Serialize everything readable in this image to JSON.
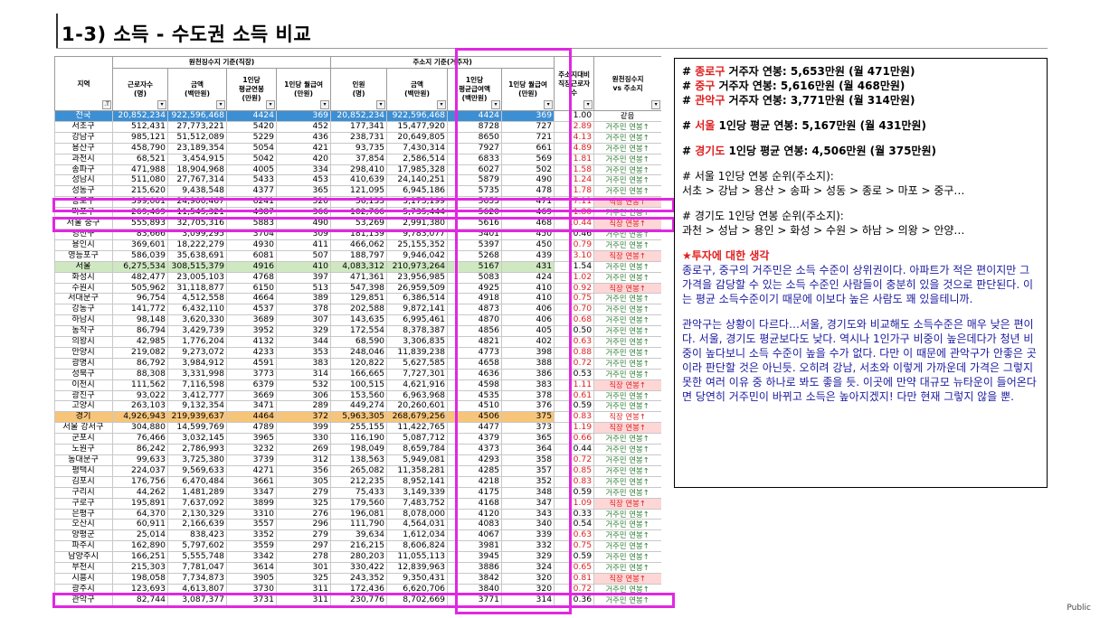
{
  "title": "1-3) 소득 - 수도권 소득 비교",
  "footer": "Public",
  "table": {
    "group_headers": {
      "workplace": "원천징수지 기준(직장)",
      "residence": "주소지 기준(거주자)"
    },
    "columns": [
      "지역",
      "근로자수\n(명)",
      "금액\n(백만원)",
      "1인당\n평균연봉\n(만원)",
      "1인당 월급여\n(만원)",
      "인원\n(명)",
      "금액\n(백만원)",
      "1인당\n평균급여액\n(백만원)",
      "1인당 월급여\n(만원)",
      "주소지대비\n직장근로자\n수",
      "원천징수지\nvs 주소지"
    ],
    "rows": [
      [
        "전국",
        "20,852,234",
        "922,596,468",
        "4424",
        "369",
        "20,852,234",
        "922,596,468",
        "4424",
        "369",
        "1.00",
        "같음",
        "blue"
      ],
      [
        "서초구",
        "512,431",
        "27,773,221",
        "5420",
        "452",
        "177,341",
        "15,477,920",
        "8728",
        "727",
        "2.89",
        "거주민 연봉↑",
        "red"
      ],
      [
        "강남구",
        "985,121",
        "51,512,089",
        "5229",
        "436",
        "238,731",
        "20,649,805",
        "8650",
        "721",
        "4.13",
        "거주민 연봉↑",
        "red"
      ],
      [
        "용산구",
        "458,790",
        "23,189,354",
        "5054",
        "421",
        "93,735",
        "7,430,314",
        "7927",
        "661",
        "4.89",
        "거주민 연봉↑",
        "red"
      ],
      [
        "과천시",
        "68,521",
        "3,454,915",
        "5042",
        "420",
        "37,854",
        "2,586,514",
        "6833",
        "569",
        "1.81",
        "거주민 연봉↑",
        "red"
      ],
      [
        "송파구",
        "471,988",
        "18,904,968",
        "4005",
        "334",
        "298,410",
        "17,985,328",
        "6027",
        "502",
        "1.58",
        "거주민 연봉↑",
        "red"
      ],
      [
        "성남시",
        "511,080",
        "27,767,314",
        "5433",
        "453",
        "410,639",
        "24,140,251",
        "5879",
        "490",
        "1.24",
        "거주민 연봉↑",
        "red"
      ],
      [
        "성동구",
        "215,620",
        "9,438,548",
        "4377",
        "365",
        "121,095",
        "6,945,186",
        "5735",
        "478",
        "1.78",
        "거주민 연봉↑",
        "red"
      ],
      [
        "종로구",
        "399,001",
        "24,900,467",
        "6241",
        "520",
        "56,133",
        "3,173,199",
        "5653",
        "471",
        "7.11",
        "직장 연봉↑",
        "red"
      ],
      [
        "마포구",
        "269,469",
        "11,545,321",
        "4387",
        "366",
        "102,766",
        "5,735,444",
        "5620",
        "469",
        "1.80",
        "거주민 연봉↑",
        "red"
      ],
      [
        "서울 중구",
        "555,893",
        "32,705,316",
        "5883",
        "490",
        "53,269",
        "2,991,380",
        "5616",
        "468",
        "10.44",
        "직장 연봉↑",
        "red"
      ],
      [
        "영천구",
        "83,666",
        "3,099,295",
        "3704",
        "309",
        "181,139",
        "9,783,077",
        "5401",
        "450",
        "0.46",
        "거주민 연봉↑",
        ""
      ],
      [
        "용인시",
        "369,601",
        "18,222,279",
        "4930",
        "411",
        "466,062",
        "25,155,352",
        "5397",
        "450",
        "0.79",
        "거주민 연봉↑",
        "red"
      ],
      [
        "영등포구",
        "586,039",
        "35,638,691",
        "6081",
        "507",
        "188,797",
        "9,946,042",
        "5268",
        "439",
        "3.10",
        "직장 연봉↑",
        "red"
      ],
      [
        "서울",
        "6,275,534",
        "308,515,379",
        "4916",
        "410",
        "4,083,312",
        "210,973,264",
        "5167",
        "431",
        "1.54",
        "거주민 연봉↑",
        "green"
      ],
      [
        "화성시",
        "482,477",
        "23,005,103",
        "4768",
        "397",
        "471,361",
        "23,956,985",
        "5083",
        "424",
        "1.02",
        "거주민 연봉↑",
        "red"
      ],
      [
        "수원시",
        "505,962",
        "31,118,877",
        "6150",
        "513",
        "547,398",
        "26,959,509",
        "4925",
        "410",
        "0.92",
        "직장 연봉↑",
        "red"
      ],
      [
        "서대문구",
        "96,754",
        "4,512,558",
        "4664",
        "389",
        "129,851",
        "6,386,514",
        "4918",
        "410",
        "0.75",
        "거주민 연봉↑",
        "red"
      ],
      [
        "강동구",
        "141,772",
        "6,432,110",
        "4537",
        "378",
        "202,588",
        "9,872,141",
        "4873",
        "406",
        "0.70",
        "거주민 연봉↑",
        "red"
      ],
      [
        "하남시",
        "98,148",
        "3,620,330",
        "3689",
        "307",
        "143,635",
        "6,995,461",
        "4870",
        "406",
        "0.68",
        "거주민 연봉↑",
        "red"
      ],
      [
        "동작구",
        "86,794",
        "3,429,739",
        "3952",
        "329",
        "172,554",
        "8,378,387",
        "4856",
        "405",
        "0.50",
        "거주민 연봉↑",
        ""
      ],
      [
        "의왕시",
        "42,985",
        "1,776,204",
        "4132",
        "344",
        "68,590",
        "3,306,835",
        "4821",
        "402",
        "0.63",
        "거주민 연봉↑",
        "red"
      ],
      [
        "안양시",
        "219,082",
        "9,273,072",
        "4233",
        "353",
        "248,046",
        "11,839,238",
        "4773",
        "398",
        "0.88",
        "거주민 연봉↑",
        "red"
      ],
      [
        "광명시",
        "86,792",
        "3,984,912",
        "4591",
        "383",
        "120,822",
        "5,627,585",
        "4658",
        "388",
        "0.72",
        "거주민 연봉↑",
        "red"
      ],
      [
        "성북구",
        "88,308",
        "3,331,998",
        "3773",
        "314",
        "166,665",
        "7,727,301",
        "4636",
        "386",
        "0.53",
        "거주민 연봉↑",
        ""
      ],
      [
        "이천시",
        "111,562",
        "7,116,598",
        "6379",
        "532",
        "100,515",
        "4,621,916",
        "4598",
        "383",
        "1.11",
        "직장 연봉↑",
        "red"
      ],
      [
        "광진구",
        "93,022",
        "3,412,777",
        "3669",
        "306",
        "153,560",
        "6,963,968",
        "4535",
        "378",
        "0.61",
        "거주민 연봉↑",
        "red"
      ],
      [
        "고양시",
        "263,103",
        "9,132,354",
        "3471",
        "289",
        "449,274",
        "20,260,601",
        "4510",
        "376",
        "0.59",
        "거주민 연봉↑",
        ""
      ],
      [
        "경기",
        "4,926,943",
        "219,939,637",
        "4464",
        "372",
        "5,963,305",
        "268,679,256",
        "4506",
        "375",
        "0.83",
        "직장 연봉↑",
        "orange"
      ],
      [
        "서울 강서구",
        "304,880",
        "14,599,769",
        "4789",
        "399",
        "255,155",
        "11,422,765",
        "4477",
        "373",
        "1.19",
        "직장 연봉↑",
        "red"
      ],
      [
        "군포시",
        "76,466",
        "3,032,145",
        "3965",
        "330",
        "116,190",
        "5,087,712",
        "4379",
        "365",
        "0.66",
        "거주민 연봉↑",
        "red"
      ],
      [
        "노원구",
        "86,242",
        "2,786,993",
        "3232",
        "269",
        "198,049",
        "8,659,784",
        "4373",
        "364",
        "0.44",
        "거주민 연봉↑",
        ""
      ],
      [
        "동대문구",
        "99,633",
        "3,725,380",
        "3739",
        "312",
        "138,563",
        "5,949,081",
        "4293",
        "358",
        "0.72",
        "거주민 연봉↑",
        "red"
      ],
      [
        "평택시",
        "224,037",
        "9,569,633",
        "4271",
        "356",
        "265,082",
        "11,358,281",
        "4285",
        "357",
        "0.85",
        "거주민 연봉↑",
        "red"
      ],
      [
        "김포시",
        "176,756",
        "6,470,484",
        "3661",
        "305",
        "212,235",
        "8,952,141",
        "4218",
        "352",
        "0.83",
        "거주민 연봉↑",
        "red"
      ],
      [
        "구리시",
        "44,262",
        "1,481,289",
        "3347",
        "279",
        "75,433",
        "3,149,339",
        "4175",
        "348",
        "0.59",
        "거주민 연봉↑",
        ""
      ],
      [
        "구로구",
        "195,891",
        "7,637,092",
        "3899",
        "325",
        "179,560",
        "7,483,752",
        "4168",
        "347",
        "1.09",
        "직장 연봉↑",
        "red"
      ],
      [
        "은평구",
        "64,370",
        "2,130,329",
        "3310",
        "276",
        "196,081",
        "8,078,000",
        "4120",
        "343",
        "0.33",
        "거주민 연봉↑",
        ""
      ],
      [
        "오산시",
        "60,911",
        "2,166,639",
        "3557",
        "296",
        "111,790",
        "4,564,031",
        "4083",
        "340",
        "0.54",
        "거주민 연봉↑",
        ""
      ],
      [
        "양평군",
        "25,014",
        "838,423",
        "3352",
        "279",
        "39,634",
        "1,612,034",
        "4067",
        "339",
        "0.63",
        "거주민 연봉↑",
        "red"
      ],
      [
        "파주시",
        "162,890",
        "5,797,602",
        "3559",
        "297",
        "216,215",
        "8,606,824",
        "3981",
        "332",
        "0.75",
        "거주민 연봉↑",
        "red"
      ],
      [
        "남양주시",
        "166,251",
        "5,555,748",
        "3342",
        "278",
        "280,203",
        "11,055,113",
        "3945",
        "329",
        "0.59",
        "거주민 연봉↑",
        ""
      ],
      [
        "부천시",
        "215,303",
        "7,781,047",
        "3614",
        "301",
        "330,422",
        "12,839,963",
        "3886",
        "324",
        "0.65",
        "거주민 연봉↑",
        "red"
      ],
      [
        "시흥시",
        "198,058",
        "7,734,873",
        "3905",
        "325",
        "243,352",
        "9,350,431",
        "3842",
        "320",
        "0.81",
        "직장 연봉↑",
        "red"
      ],
      [
        "광주시",
        "123,693",
        "4,613,807",
        "3730",
        "311",
        "172,436",
        "6,620,706",
        "3840",
        "320",
        "0.72",
        "거주민 연봉↑",
        "red"
      ],
      [
        "관악구",
        "82,744",
        "3,087,377",
        "3731",
        "311",
        "230,776",
        "8,702,669",
        "3771",
        "314",
        "0.36",
        "거주민 연봉↑",
        ""
      ]
    ]
  },
  "notes": {
    "line1": {
      "prefix": "# ",
      "region": "종로구",
      "text": " 거주자 연봉: 5,653만원 (월 471만원)"
    },
    "line2": {
      "prefix": "# ",
      "region": "중구",
      "text": " 거주자 연봉: 5,616만원 (월 468만원)"
    },
    "line3": {
      "prefix": "# ",
      "region": "관악구",
      "text": " 거주자 연봉: 3,771만원 (월 314만원)"
    },
    "line4": {
      "prefix": "# ",
      "region": "서울",
      "text": " 1인당 평균 연봉: 5,167만원 (월 431만원)"
    },
    "line5": {
      "prefix": "# ",
      "region": "경기도",
      "text": " 1인당 평균 연봉: 4,506만원 (월 375만원)"
    },
    "rank_seoul_title": "# 서울 1인당 연봉 순위(주소지):",
    "rank_seoul": "서초 > 강남 > 용산 > 송파 > 성동 > 종로 > 마포 > 중구…",
    "rank_gg_title": "# 경기도 1인당 연봉 순위(주소지):",
    "rank_gg": "과천 > 성남 > 용인 > 화성 > 수원 > 하남 > 의왕 > 안양…",
    "opinion_title": "★투자에 대한 생각",
    "para1": "종로구, 중구의 거주민은 소득 수준이 상위권이다. 아파트가 적은 편이지만 그 가격을 감당할 수 있는 소득 수준인 사람들이 충분히 있을 것으로 판단된다. 이는 평균 소득수준이기 때문에 이보다 높은 사람도 꽤 있을테니까.",
    "para2": "관악구는 상황이 다르다…서울, 경기도와 비교해도 소득수준은 매우 낮은 편이다. 서울, 경기도 평균보다도 낮다. 역시나 1인가구 비중이 높은데다가 청년 비중이 높다보니 소득 수준이 높을 수가 없다. 다만 이 때문에 관악구가 안좋은 곳이라 판단할 것은 아닌듯. 오히려 강남, 서초와 이렇게 가까운데 가격은 그렇지 못한 여러 이유 중 하나로 봐도 좋을 듯. 이곳에 만약 대규모 뉴타운이 들어온다면 당연히 거주민이 바뀌고 소득은 높아지겠지! 다만 현재 그렇지 않을 뿐."
  },
  "colors": {
    "highlight": "#e028e0",
    "header_blue": "#3d8fd4",
    "seoul_green": "#cfe8c1",
    "gyeonggi_orange": "#f7c57a",
    "red_text": "#e02020",
    "note_blue": "#1a1aa0"
  }
}
